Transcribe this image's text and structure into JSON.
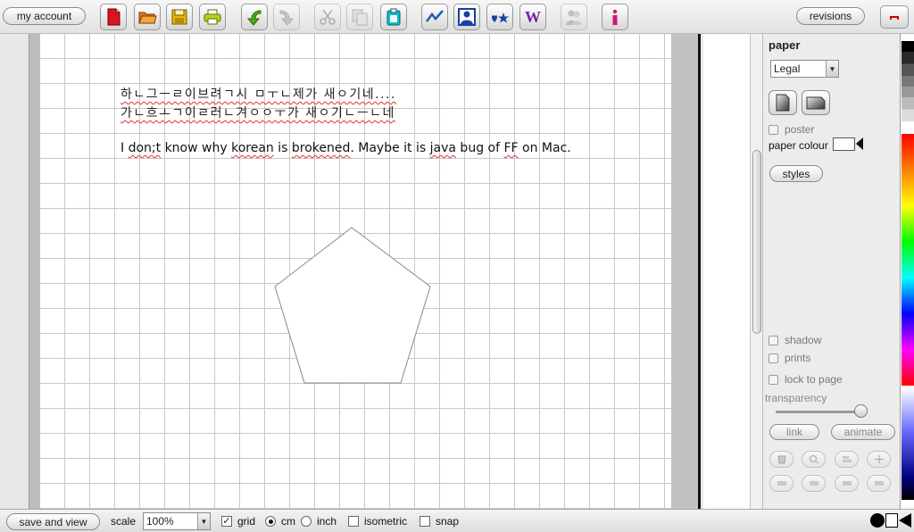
{
  "toolbar": {
    "my_account": "my account",
    "revisions": "revisions"
  },
  "canvas": {
    "korean_line1": "하ㄴ그ㅡㄹ이브려ㄱ시 ㅁㅜㄴ제가 새ㅇ기네....",
    "korean_line2": "가ㄴ흐ㅗㄱ이ㄹ러ㄴ겨ㅇㅇㅜ가 새ㅇ기ㄴㅡㄴ네",
    "english": {
      "p1": "I ",
      "w1": "don;t",
      "p2": " know why ",
      "w2": "korean",
      "p3": " is ",
      "w3": "brokened",
      "p4": ".  Maybe it is ",
      "w4": "java",
      "p5": " bug of ",
      "w5": "FF",
      "p6": " on Mac."
    }
  },
  "panel": {
    "title": "paper",
    "paper_size": "Legal",
    "poster": "poster",
    "paper_colour": "paper colour",
    "styles": "styles",
    "shadow": "shadow",
    "prints": "prints",
    "lock_to_page": "lock to page",
    "transparency": "transparency",
    "transparency_value": 1.0,
    "link": "link",
    "animate": "animate"
  },
  "bottom": {
    "save_and_view": "save and view",
    "scale_label": "scale",
    "scale_value": "100%",
    "grid": "grid",
    "grid_checked": true,
    "cm": "cm",
    "inch": "inch",
    "unit_selected": "cm",
    "isometric": "isometric",
    "snap": "snap"
  },
  "colors": {
    "spellcheck": "#e03030",
    "text_primary": "#111111"
  },
  "icons": {
    "toolbar": [
      "new-document-icon",
      "open-folder-icon",
      "save-icon",
      "print-icon",
      "undo-icon",
      "redo-icon",
      "cut-icon",
      "copy-icon",
      "paste-icon",
      "chart-icon",
      "contact-icon",
      "symbols-icon",
      "wiki-icon",
      "people-icon",
      "info-icon",
      "minimize-icon"
    ]
  }
}
